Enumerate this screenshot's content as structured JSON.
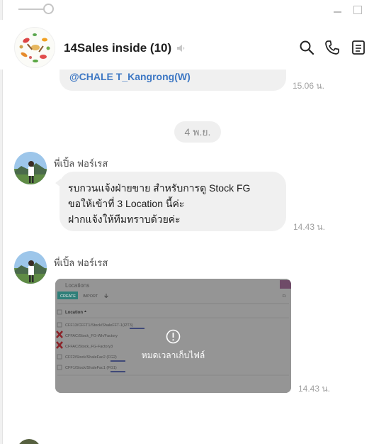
{
  "window": {
    "zoom_slider_value": 1.0
  },
  "chat": {
    "title": "14Sales inside (10)",
    "muted": true
  },
  "messages": [
    {
      "mention": "@CHALE T_Kangrong(W)",
      "time": "15.06 น."
    },
    {
      "date_separator": "4 พ.ย."
    },
    {
      "sender": "พี่เปิ้ล ฟอร์เรส",
      "lines": [
        "รบกวนแจ้งฝ่ายขาย สำหรับการดู Stock FG",
        "ขอให้เข้าที่ 3 Location นี้ค่ะ",
        "ฝากแจ้งให้ทีมทราบด้วยค่ะ"
      ],
      "time": "14.43 น."
    },
    {
      "sender": "พี่เปิ้ล ฟอร์เรส",
      "image_status": "หมดเวลาเก็บไฟล์",
      "time": "14.43 น.",
      "preview": {
        "title": "Locations",
        "create_button": "CREATE",
        "import_button": "IMPORT",
        "column_header": "Location",
        "filters_label": "Fi",
        "rows": [
          "CFF13/CFFT1/Stock/ShaleFFT-1(I2T3)",
          "CFFAC/Stock_FG-Wh/Factory",
          "CFFAC/Stock_FG-Factory3",
          "CFF2/Stock/ShaleFac2 (FG2)",
          "CFF1/Stock/ShaleFac1 (FG1)"
        ]
      }
    }
  ],
  "colors": {
    "bubble": "#f0f0f0",
    "mention": "#3e78c4",
    "timestamp": "#a0a0a0",
    "image_overlay": "#8e8e8e",
    "create_button": "#2a8f87"
  },
  "icons": [
    "zoom-slider-knob",
    "minimize-icon",
    "maximize-icon",
    "speaker-muted-icon",
    "search-icon",
    "phone-icon",
    "note-icon",
    "timeout-icon"
  ]
}
